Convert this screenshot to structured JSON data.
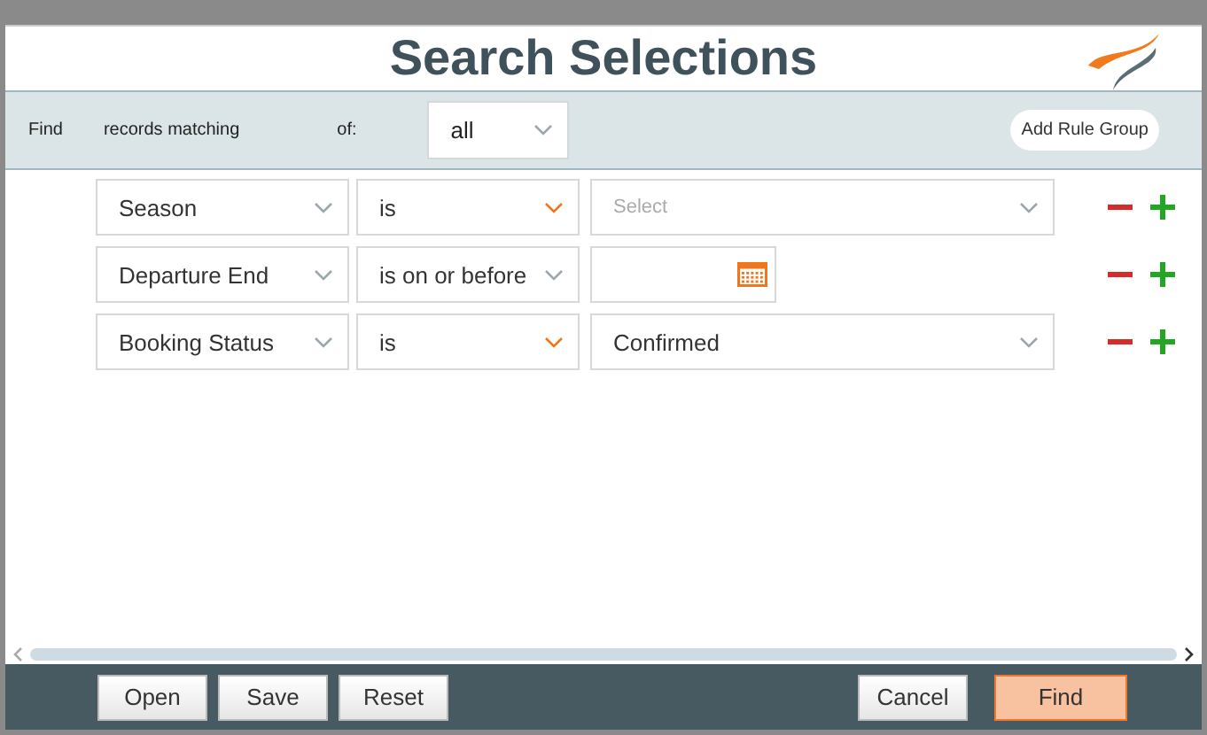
{
  "window": {
    "title": "Search Selections"
  },
  "filter_bar": {
    "find_label": "Find",
    "records_label": "records matching",
    "of_label": "of:",
    "match": "all",
    "add_group_button": "Add Rule Group"
  },
  "rules": [
    {
      "field": "Season",
      "operator": "is",
      "operator_highlighted": true,
      "kind": "select",
      "placeholder": "Select"
    },
    {
      "field": "Departure End",
      "operator": "is on or before",
      "operator_highlighted": false,
      "kind": "date"
    },
    {
      "field": "Booking Status",
      "operator": "is",
      "operator_highlighted": true,
      "kind": "select",
      "value": "Confirmed"
    }
  ],
  "footer": {
    "left_buttons": [
      "Open",
      "Save",
      "Reset"
    ],
    "cancel_button": "Cancel",
    "find_button": "Find"
  }
}
